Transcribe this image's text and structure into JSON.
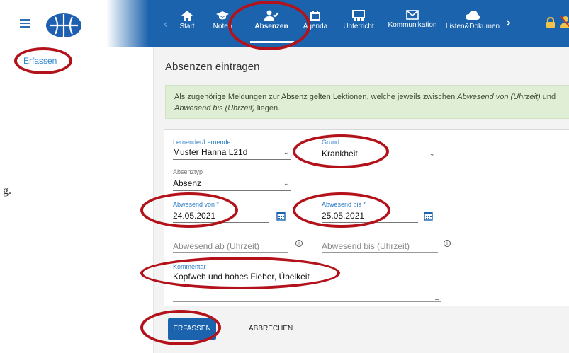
{
  "navbar": {
    "items": [
      {
        "label": "Start",
        "icon": "home-icon"
      },
      {
        "label": "Noten",
        "icon": "graduation-cap-icon"
      },
      {
        "label": "Absenzen",
        "icon": "user-check-icon"
      },
      {
        "label": "Agenda",
        "icon": "calendar-icon"
      },
      {
        "label": "Unterricht",
        "icon": "classroom-icon"
      },
      {
        "label": "Kommunikation",
        "icon": "envelope-icon"
      },
      {
        "label": "Listen&Dokumen",
        "icon": "cloud-icon"
      }
    ],
    "active": "Absenzen"
  },
  "sidebar": {
    "items": [
      {
        "label": "Erfassen"
      }
    ],
    "cut_text": "g."
  },
  "main": {
    "title": "Absenzen eintragen",
    "info": {
      "part1": "Als zugehörige Meldungen zur Absenz gelten Lektionen, welche jeweils zwischen ",
      "em1": "Abwesend von (Uhrzeit)",
      "part2": " und ",
      "em2": "Abwesend bis (Uhrzeit)",
      "part3": " liegen."
    }
  },
  "form": {
    "lernender": {
      "label": "Lernender/Lernende",
      "value": "Muster Hanna L21d"
    },
    "grund": {
      "label": "Grund",
      "value": "Krankheit"
    },
    "absenztyp": {
      "label": "Absenztyp",
      "value": "Absenz"
    },
    "abwesend_von": {
      "label": "Abwesend von *",
      "value": "24.05.2021"
    },
    "abwesend_bis": {
      "label": "Abwesend bis *",
      "value": "25.05.2021"
    },
    "abwesend_ab_uhrzeit": {
      "placeholder": "Abwesend ab (Uhrzeit)"
    },
    "abwesend_bis_uhrzeit": {
      "placeholder": "Abwesend bis (Uhrzeit)"
    },
    "kommentar": {
      "label": "Kommentar",
      "value": "Kopfweh und hohes Fieber, Übelkeit"
    }
  },
  "actions": {
    "submit": "ERFASSEN",
    "cancel": "ABBRECHEN"
  },
  "colors": {
    "navbar": "#1b63ad",
    "accent": "#2f7fc5",
    "info_bg": "#dfeed5",
    "highlight_ring": "#b3121b"
  }
}
